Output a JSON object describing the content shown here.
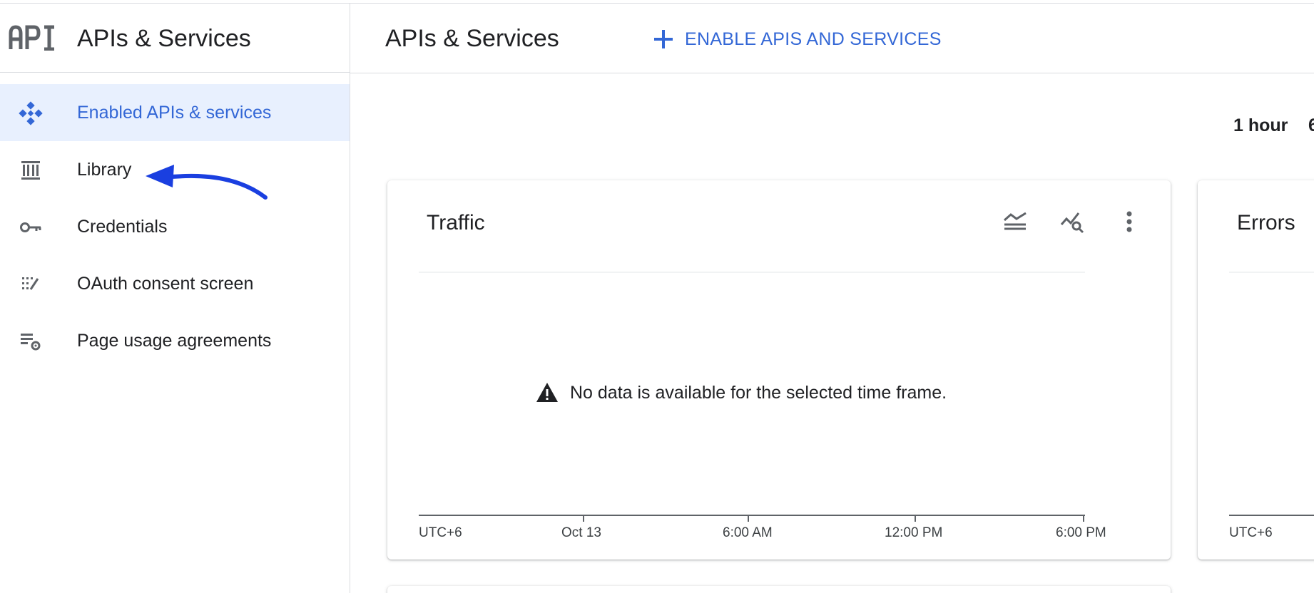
{
  "sidebar": {
    "brand_title": "APIs & Services",
    "logo_text": "API",
    "items": [
      {
        "label": "Enabled APIs & services",
        "icon": "api-diamond-icon",
        "active": true
      },
      {
        "label": "Library",
        "icon": "library-icon",
        "active": false
      },
      {
        "label": "Credentials",
        "icon": "key-icon",
        "active": false
      },
      {
        "label": "OAuth consent screen",
        "icon": "oauth-consent-icon",
        "active": false
      },
      {
        "label": "Page usage agreements",
        "icon": "settings-list-icon",
        "active": false
      }
    ]
  },
  "header": {
    "title": "APIs & Services",
    "enable_button_label": "ENABLE APIS AND SERVICES",
    "enable_button_icon": "plus-icon"
  },
  "time_range": {
    "selected": "1 hour",
    "next_option_partial": "6"
  },
  "cards": {
    "traffic": {
      "title": "Traffic",
      "empty_message": "No data is available for the selected time frame.",
      "axis_labels": [
        "UTC+6",
        "Oct 13",
        "6:00 AM",
        "12:00 PM",
        "6:00 PM"
      ],
      "tools": [
        "legend-lines-icon",
        "explore-chart-icon",
        "more-vert-icon"
      ]
    },
    "errors": {
      "title": "Errors",
      "axis_label": "UTC+6"
    }
  },
  "colors": {
    "accent": "#3367d6",
    "active_bg": "#e8f0fe",
    "divider": "#dadce0",
    "annotation_arrow": "#1a3fe0",
    "text": "#202124",
    "icon_gray": "#5f6368"
  }
}
